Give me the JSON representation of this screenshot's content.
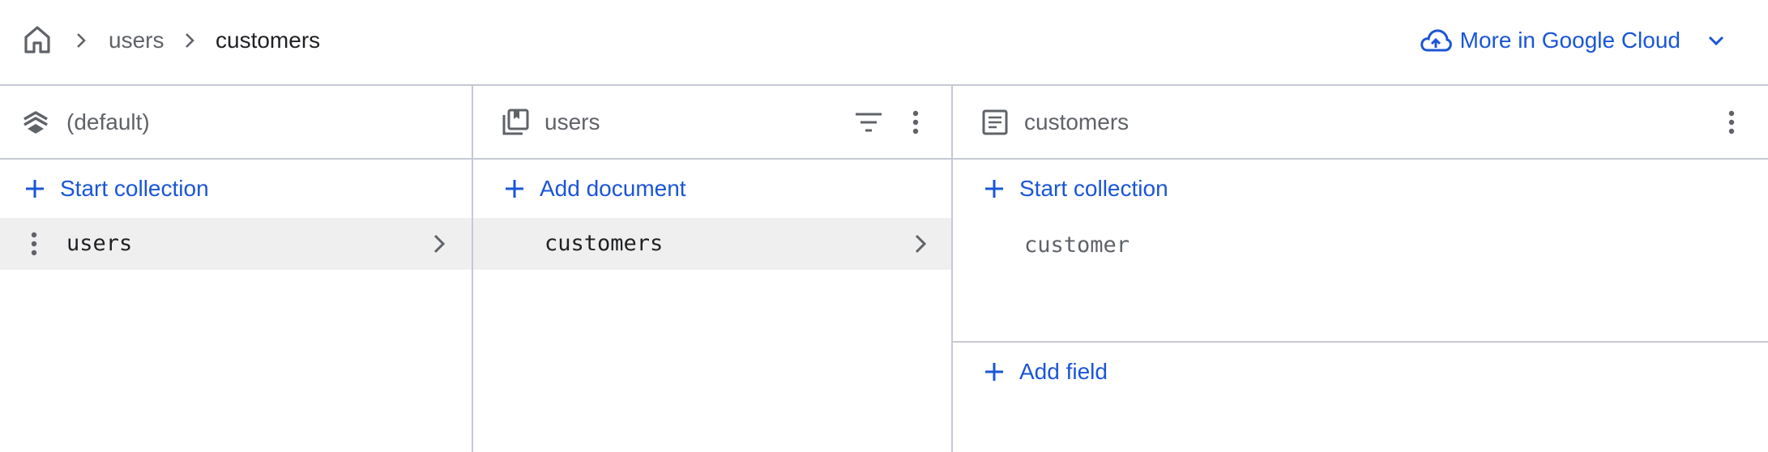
{
  "breadcrumb": {
    "home_icon": "home-icon",
    "items": [
      "users",
      "customers"
    ]
  },
  "gcloud": {
    "label": "More in Google Cloud",
    "icon": "cloud-icon",
    "accent": "#1a56d6"
  },
  "panels": {
    "database": {
      "title": "(default)",
      "icon": "database-icon",
      "action": "Start collection",
      "items": [
        {
          "label": "users",
          "selected": true
        }
      ]
    },
    "collection": {
      "title": "users",
      "icon": "collection-icon",
      "action": "Add document",
      "items": [
        {
          "label": "customers",
          "selected": true
        }
      ]
    },
    "document": {
      "title": "customers",
      "icon": "document-icon",
      "action": "Start collection",
      "subcollections": [
        "customer"
      ],
      "field_action": "Add field"
    }
  }
}
